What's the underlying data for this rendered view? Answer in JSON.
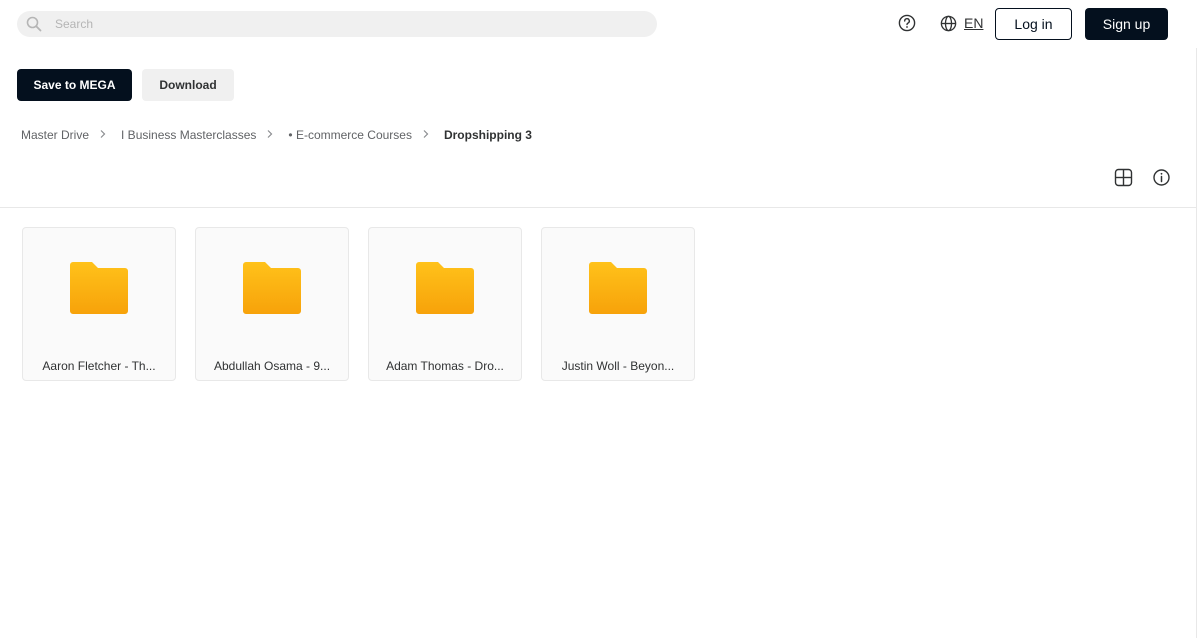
{
  "header": {
    "search_placeholder": "Search",
    "language": "EN",
    "login_label": "Log in",
    "signup_label": "Sign up"
  },
  "actions": {
    "save_label": "Save to MEGA",
    "download_label": "Download"
  },
  "breadcrumb": {
    "items": [
      "Master Drive",
      "I Business Masterclasses",
      "• E-commerce Courses"
    ],
    "current": "Dropshipping 3"
  },
  "folders": [
    {
      "name": "Aaron Fletcher - Th..."
    },
    {
      "name": "Abdullah Osama - 9..."
    },
    {
      "name": "Adam Thomas - Dro..."
    },
    {
      "name": "Justin Woll - Beyon..."
    }
  ],
  "colors": {
    "primary_dark": "#04101e",
    "folder_top": "#ffc21a",
    "folder_bottom": "#f7a20a",
    "neutral_bg": "#f0f0f0"
  },
  "icons": {
    "search": "search-icon",
    "help": "question-circle-icon",
    "language": "globe-icon",
    "breadcrumb_separator": "chevron-right-icon",
    "view": "grid-view-icon",
    "info": "info-icon",
    "folder": "folder-icon"
  }
}
